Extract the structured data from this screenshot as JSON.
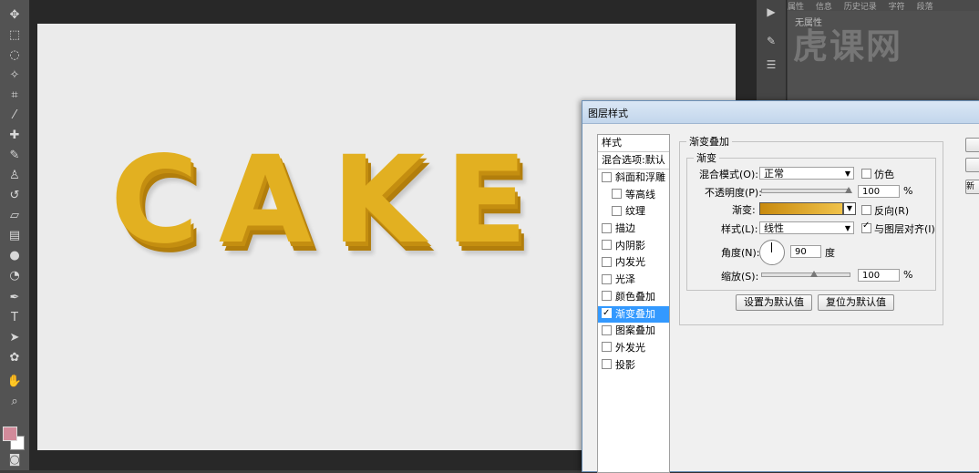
{
  "canvas": {
    "text": "CAKE"
  },
  "props_panel": {
    "tabs": [
      "属性",
      "信息",
      "历史记录",
      "字符",
      "段落"
    ],
    "empty_label": "无属性"
  },
  "watermark": {
    "text": "虎课网"
  },
  "dialog": {
    "title": "图层样式",
    "styles_header": "样式",
    "blend_default": "混合选项:默认",
    "items": [
      {
        "label": "斜面和浮雕",
        "checked": false,
        "sub": false
      },
      {
        "label": "等高线",
        "checked": false,
        "sub": true
      },
      {
        "label": "纹理",
        "checked": false,
        "sub": true
      },
      {
        "label": "描边",
        "checked": false,
        "sub": false
      },
      {
        "label": "内阴影",
        "checked": false,
        "sub": false
      },
      {
        "label": "内发光",
        "checked": false,
        "sub": false
      },
      {
        "label": "光泽",
        "checked": false,
        "sub": false
      },
      {
        "label": "颜色叠加",
        "checked": false,
        "sub": false
      },
      {
        "label": "渐变叠加",
        "checked": true,
        "sub": false,
        "selected": true
      },
      {
        "label": "图案叠加",
        "checked": false,
        "sub": false
      },
      {
        "label": "外发光",
        "checked": false,
        "sub": false
      },
      {
        "label": "投影",
        "checked": false,
        "sub": false
      }
    ],
    "section_title": "渐变叠加",
    "subsection_title": "渐变",
    "blend_mode_label": "混合模式(O):",
    "blend_mode_value": "正常",
    "dither_label": "仿色",
    "opacity_label": "不透明度(P):",
    "opacity_value": "100",
    "percent": "%",
    "gradient_label": "渐变:",
    "reverse_label": "反向(R)",
    "style_label": "样式(L):",
    "style_value": "线性",
    "align_label": "与图层对齐(I)",
    "angle_label": "角度(N):",
    "angle_value": "90",
    "degree": "度",
    "scale_label": "缩放(S):",
    "scale_value": "100",
    "make_default": "设置为默认值",
    "reset_default": "复位为默认值",
    "side_btn_partial": "新"
  }
}
